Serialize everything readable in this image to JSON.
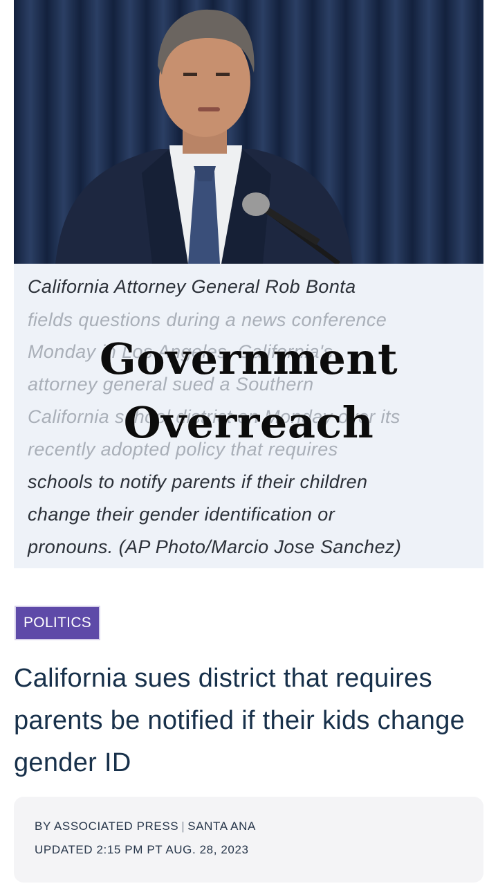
{
  "photo": {
    "alt": "California Attorney General Rob Bonta at a microphone"
  },
  "caption": {
    "lines": [
      "California Attorney General Rob Bonta",
      "fields questions during a news conference",
      "Monday in Los Angeles. California's",
      "attorney general sued a Southern",
      "California school district on Monday over its",
      "recently adopted policy that requires",
      "schools to notify parents if their children",
      "change their gender identification or",
      "pronouns. (AP Photo/Marcio Jose Sanchez)"
    ]
  },
  "overlay": {
    "line1": "Government",
    "line2": "Overreach"
  },
  "article": {
    "category": "POLITICS",
    "headline": "California sues district that requires parents be notified if their kids change gender ID",
    "byline_author": "BY ASSOCIATED PRESS",
    "byline_separator": "|",
    "byline_location": "SANTA ANA",
    "updated": "UPDATED 2:15 PM PT AUG. 28, 2023"
  },
  "colors": {
    "tag_bg": "#5e4aa8",
    "headline": "#17304a",
    "caption_bg": "#eef2f8"
  }
}
